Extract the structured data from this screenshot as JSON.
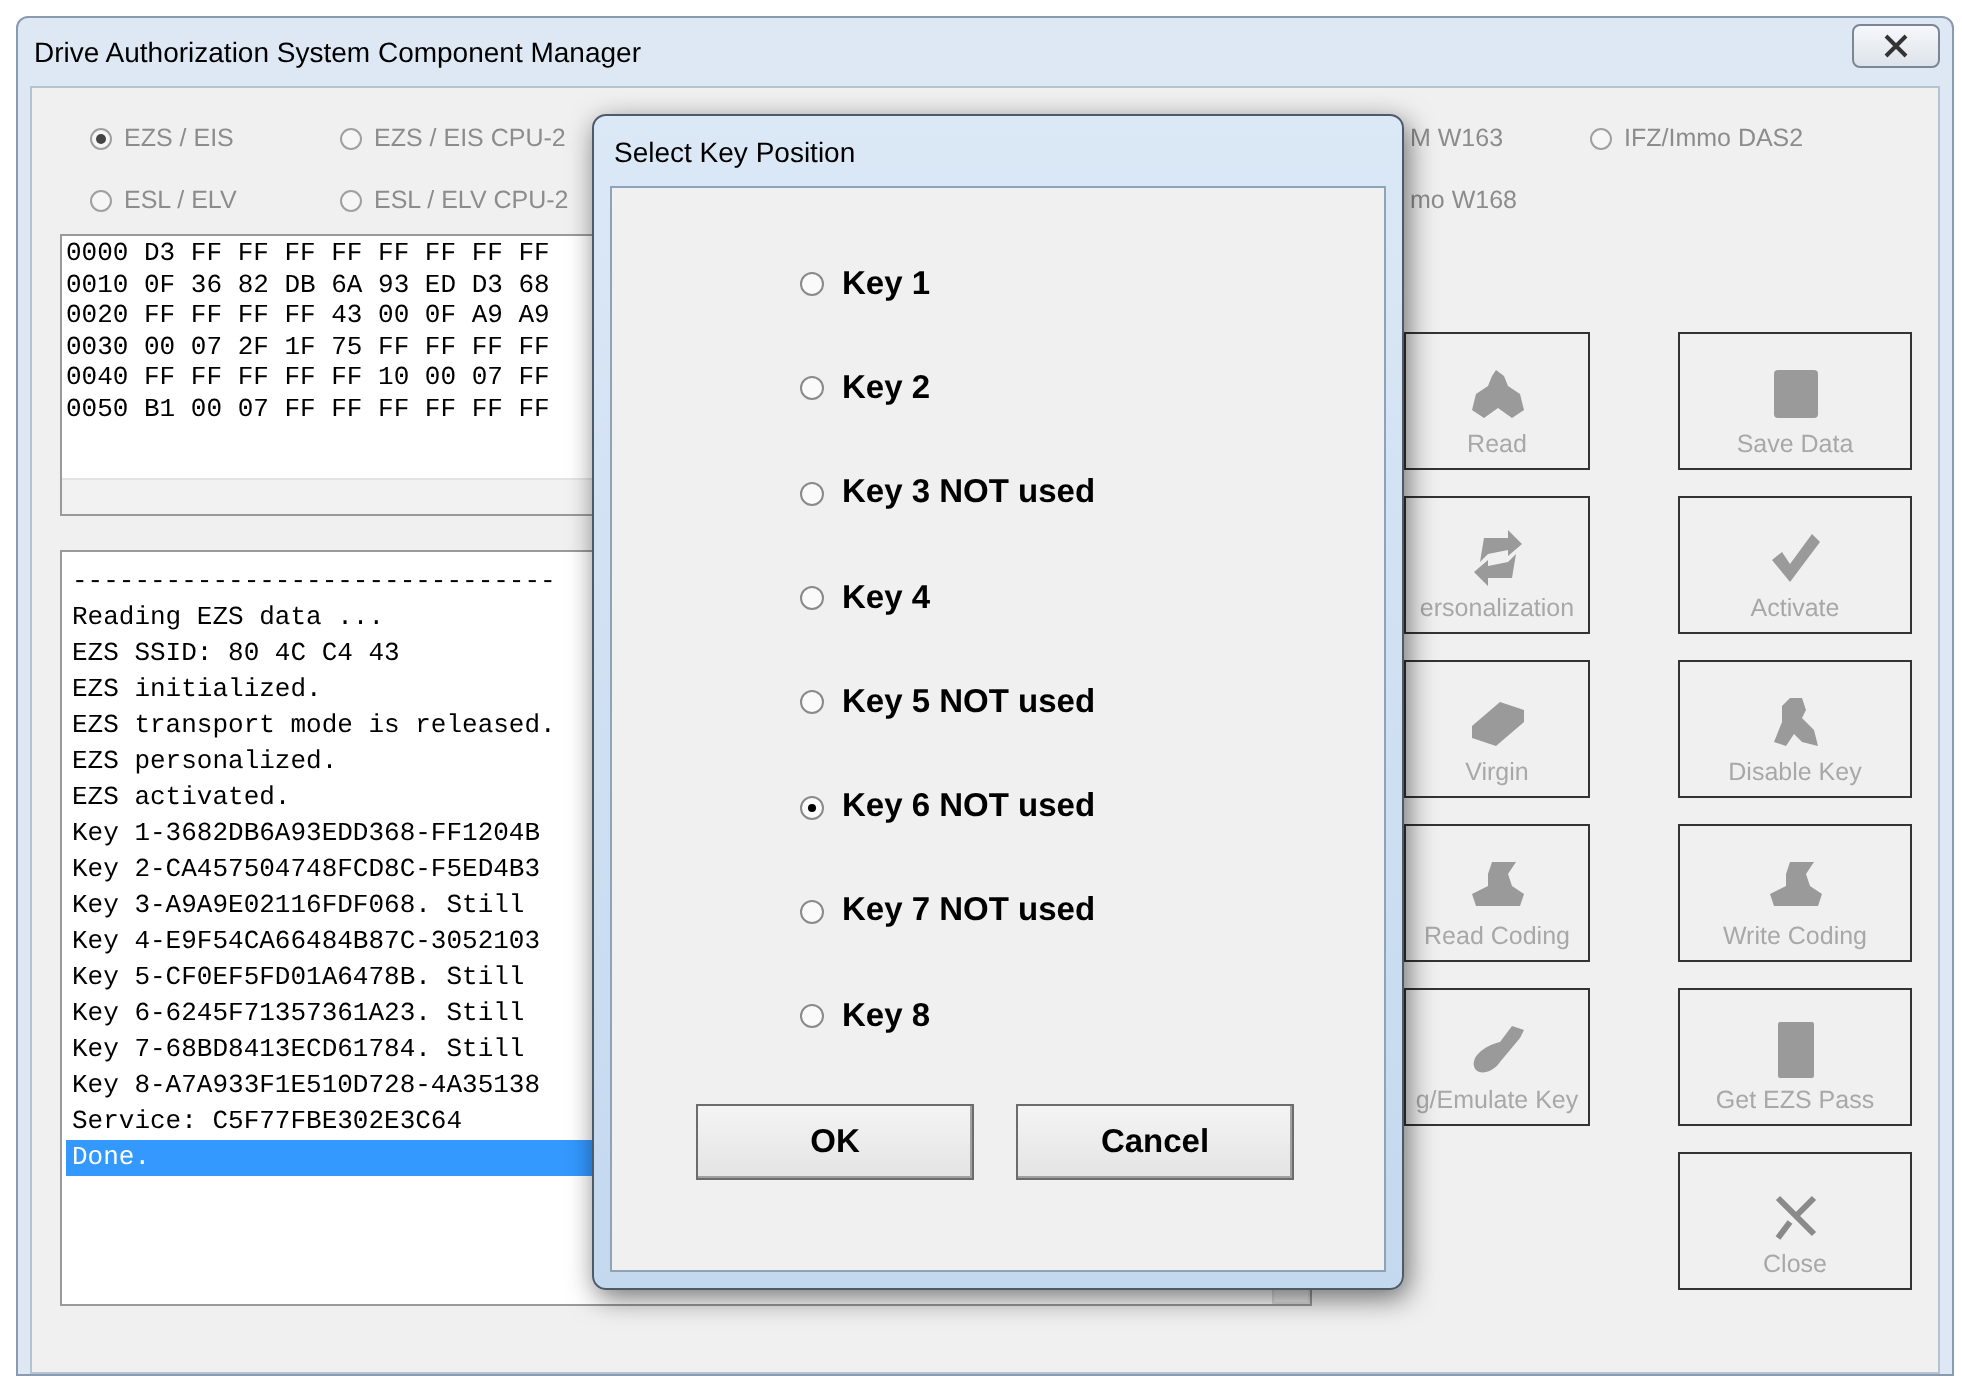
{
  "window": {
    "title": "Drive Authorization System Component Manager"
  },
  "modules": [
    {
      "label": "EZS / EIS",
      "kind": "radio",
      "selected": true
    },
    {
      "label": "EZS / EIS CPU-2",
      "kind": "radio",
      "selected": false
    },
    {
      "label": "M W163",
      "kind": "partial"
    },
    {
      "label": "IFZ/Immo DAS2",
      "kind": "radio",
      "selected": false
    },
    {
      "label": "ESL / ELV",
      "kind": "radio",
      "selected": false
    },
    {
      "label": "ESL / ELV CPU-2",
      "kind": "radio",
      "selected": false
    },
    {
      "label": "mo W168",
      "kind": "partial"
    }
  ],
  "hex_dump": [
    "0000 D3 FF FF FF FF FF FF FF FF",
    "0010 0F 36 82 DB 6A 93 ED D3 68",
    "0020 FF FF FF FF 43 00 0F A9 A9",
    "0030 00 07 2F 1F 75 FF FF FF FF",
    "0040 FF FF FF FF FF 10 00 07 FF",
    "0050 B1 00 07 FF FF FF FF FF FF"
  ],
  "log": [
    {
      "text": "-------------------------------",
      "selected": false
    },
    {
      "text": "Reading EZS data ...",
      "selected": false
    },
    {
      "text": "EZS SSID: 80 4C C4 43",
      "selected": false
    },
    {
      "text": "EZS initialized.",
      "selected": false
    },
    {
      "text": "EZS transport mode is released.",
      "selected": false
    },
    {
      "text": "EZS personalized.",
      "selected": false
    },
    {
      "text": "EZS activated.",
      "selected": false
    },
    {
      "text": "Key 1-3682DB6A93EDD368-FF1204B",
      "selected": false
    },
    {
      "text": "Key 2-CA457504748FCD8C-F5ED4B3",
      "selected": false
    },
    {
      "text": "Key 3-A9A9E02116FDF068. Still",
      "selected": false
    },
    {
      "text": "Key 4-E9F54CA66484B87C-3052103",
      "selected": false
    },
    {
      "text": "Key 5-CF0EF5FD01A6478B. Still",
      "selected": false
    },
    {
      "text": "Key 6-6245F71357361A23. Still",
      "selected": false
    },
    {
      "text": "Key 7-68BD8413ECD61784. Still",
      "selected": false
    },
    {
      "text": "Key 8-A7A933F1E510D728-4A35138",
      "selected": false
    },
    {
      "text": "Service: C5F77FBE302E3C64",
      "selected": false
    },
    {
      "text": "Done.",
      "selected": true
    }
  ],
  "actions": [
    {
      "label": "Read",
      "kind": "figure",
      "disabled": true
    },
    {
      "label": "Save Data",
      "kind": "square",
      "disabled": true
    },
    {
      "label": "ersonalization",
      "kind": "refresh",
      "disabled": true
    },
    {
      "label": "Activate",
      "kind": "check",
      "disabled": true
    },
    {
      "label": "Virgin",
      "kind": "bar",
      "disabled": true
    },
    {
      "label": "Disable Key",
      "kind": "key",
      "disabled": true
    },
    {
      "label": "Read Coding",
      "kind": "blob",
      "disabled": true
    },
    {
      "label": "Write Coding",
      "kind": "blob",
      "disabled": true
    },
    {
      "label": "g/Emulate Key",
      "kind": "fob",
      "disabled": true
    },
    {
      "label": "Get EZS Pass",
      "kind": "rect",
      "disabled": true
    },
    {
      "label": "Close",
      "kind": "cross",
      "disabled": true
    }
  ],
  "dialog": {
    "title": "Select Key Position",
    "options": [
      {
        "label": "Key 1",
        "selected": false
      },
      {
        "label": "Key 2",
        "selected": false
      },
      {
        "label": "Key 3 NOT used",
        "selected": false
      },
      {
        "label": "Key 4",
        "selected": false
      },
      {
        "label": "Key 5 NOT used",
        "selected": false
      },
      {
        "label": "Key 6 NOT used",
        "selected": true
      },
      {
        "label": "Key 7 NOT used",
        "selected": false
      },
      {
        "label": "Key 8",
        "selected": false
      }
    ],
    "buttons": [
      "OK",
      "Cancel"
    ]
  }
}
